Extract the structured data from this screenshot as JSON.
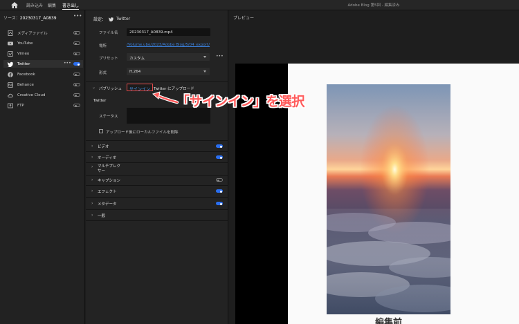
{
  "topbar": {
    "tabs": [
      "読み込み",
      "編集",
      "書き出し"
    ],
    "active_tab": "書き出し",
    "doc_title": "Adobe Blog 第5回 - 編集済み"
  },
  "left": {
    "source_label": "ソース：",
    "source_value": "20230317_A0839",
    "items": [
      {
        "label": "メディアファイル",
        "icon": "media-file-icon",
        "on": false
      },
      {
        "label": "YouTube",
        "icon": "youtube-icon",
        "on": false
      },
      {
        "label": "Vimeo",
        "icon": "vimeo-icon",
        "on": false
      },
      {
        "label": "Twitter",
        "icon": "twitter-icon",
        "on": true
      },
      {
        "label": "Facebook",
        "icon": "facebook-icon",
        "on": false
      },
      {
        "label": "Behance",
        "icon": "behance-icon",
        "on": false
      },
      {
        "label": "Creative Cloud",
        "icon": "creative-cloud-icon",
        "on": false
      },
      {
        "label": "FTP",
        "icon": "ftp-icon",
        "on": false
      }
    ]
  },
  "settings": {
    "header_label": "設定：",
    "header_value": "Twitter",
    "filename_label": "ファイル名",
    "filename_value": "20230317_A0839.mp4",
    "location_label": "場所",
    "location_value": "/Volume.ube/2023/Adobe Blog/5/04_export/",
    "preset_label": "プリセット",
    "preset_value": "カスタム",
    "format_label": "形式",
    "format_value": "H.264",
    "publish_label": "パブリッシュ",
    "signin_label": "サインイン",
    "upload_label": "Twitter にアップロード",
    "twitter_label": "Twitter",
    "status_label": "ステータス",
    "delete_local_label": "アップロード後にローカルファイルを削除",
    "sections": [
      {
        "label": "ビデオ",
        "on": true
      },
      {
        "label": "オーディオ",
        "on": true
      },
      {
        "label": "マルチプレクサー",
        "on": null
      },
      {
        "label": "キャプション",
        "on": false
      },
      {
        "label": "エフェクト",
        "on": true
      },
      {
        "label": "メタデータ",
        "on": true
      },
      {
        "label": "一般",
        "on": null
      }
    ]
  },
  "preview": {
    "header": "プレビュー",
    "caption": "編集前"
  },
  "annotation": {
    "text": "「サインイン」を選択",
    "color": "#ff5b5b"
  },
  "colors": {
    "accent": "#2b6ff0",
    "link": "#3b7fd9",
    "highlight": "#e24a4a"
  }
}
